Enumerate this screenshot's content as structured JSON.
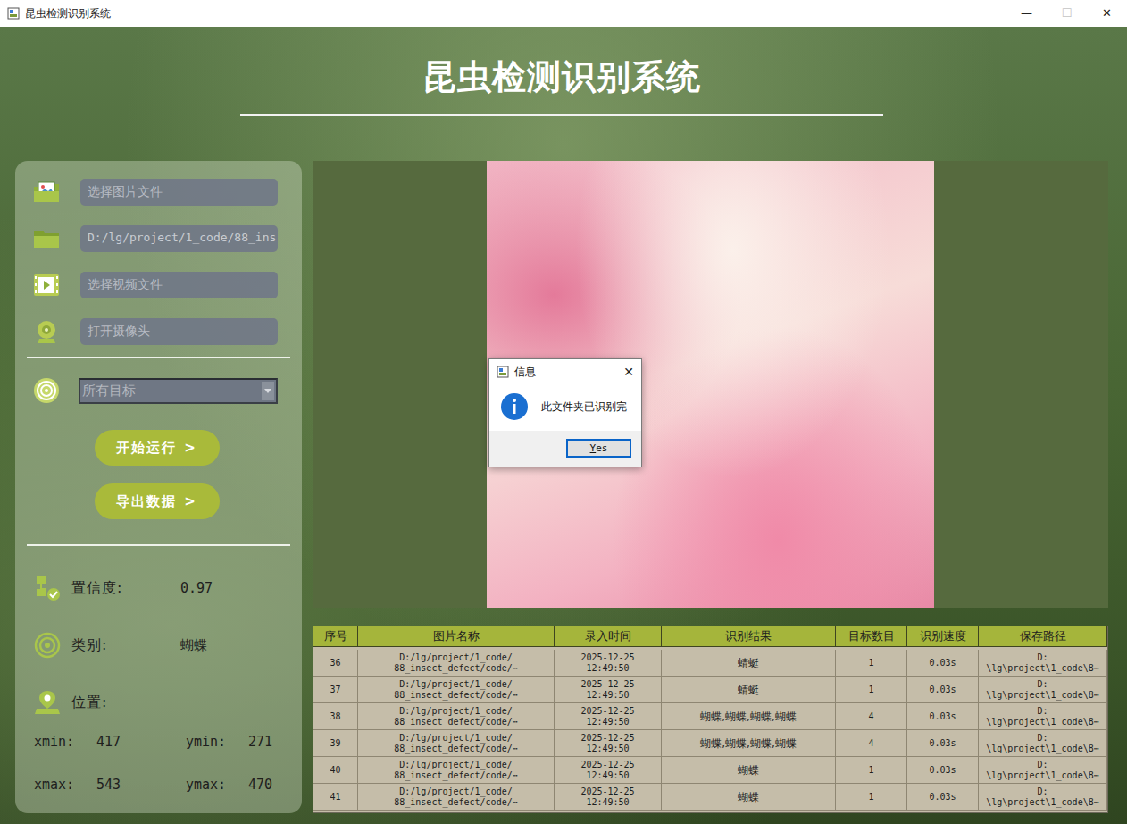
{
  "window": {
    "title": "昆虫检测识别系统",
    "controls": [
      {
        "glyph": "—",
        "disabled": false
      },
      {
        "glyph": "☐",
        "disabled": true
      },
      {
        "glyph": "✕",
        "disabled": false
      }
    ]
  },
  "header": {
    "title": "昆虫检测识别系统"
  },
  "inputs": [
    {
      "kind": "image",
      "text": "选择图片文件",
      "filled": false
    },
    {
      "kind": "folder",
      "text": "D:/lg/project/1_code/88_ins",
      "filled": true
    },
    {
      "kind": "video",
      "text": "选择视频文件",
      "filled": false
    },
    {
      "kind": "camera",
      "text": "打开摄像头",
      "filled": false
    }
  ],
  "target_select": {
    "value": "所有目标"
  },
  "buttons": [
    {
      "label": "开始运行",
      "chevron": ">"
    },
    {
      "label": "导出数据",
      "chevron": ">"
    }
  ],
  "stats": {
    "confidence": {
      "label": "置信度:",
      "value": "0.97"
    },
    "category": {
      "label": "类别:",
      "value": "蝴蝶"
    },
    "position": {
      "label": "位置:"
    },
    "coords": [
      {
        "label": "xmin:",
        "value": "417"
      },
      {
        "label": "ymin:",
        "value": "271"
      },
      {
        "label": "xmax:",
        "value": "543"
      },
      {
        "label": "ymax:",
        "value": "470"
      }
    ]
  },
  "dialog": {
    "title": "信息",
    "close": "✕",
    "message": "此文件夹已识别完",
    "button": "Yes"
  },
  "table": {
    "columns": [
      "序号",
      "图片名称",
      "录入时间",
      "识别结果",
      "目标数目",
      "识别速度",
      "保存路径"
    ],
    "rows": [
      {
        "index": "36",
        "name": [
          "D:/lg/project/1_code/",
          "88_insect_defect/code/⋯"
        ],
        "time": [
          "2025-12-25",
          "12:49:50"
        ],
        "result": "蜻蜓",
        "count": "1",
        "speed": "0.03s",
        "path": [
          "D:",
          "\\lg\\project\\1_code\\8⋯"
        ]
      },
      {
        "index": "37",
        "name": [
          "D:/lg/project/1_code/",
          "88_insect_defect/code/⋯"
        ],
        "time": [
          "2025-12-25",
          "12:49:50"
        ],
        "result": "蜻蜓",
        "count": "1",
        "speed": "0.03s",
        "path": [
          "D:",
          "\\lg\\project\\1_code\\8⋯"
        ]
      },
      {
        "index": "38",
        "name": [
          "D:/lg/project/1_code/",
          "88_insect_defect/code/⋯"
        ],
        "time": [
          "2025-12-25",
          "12:49:50"
        ],
        "result": "蝴蝶,蝴蝶,蝴蝶,蝴蝶",
        "count": "4",
        "speed": "0.03s",
        "path": [
          "D:",
          "\\lg\\project\\1_code\\8⋯"
        ]
      },
      {
        "index": "39",
        "name": [
          "D:/lg/project/1_code/",
          "88_insect_defect/code/⋯"
        ],
        "time": [
          "2025-12-25",
          "12:49:50"
        ],
        "result": "蝴蝶,蝴蝶,蝴蝶,蝴蝶",
        "count": "4",
        "speed": "0.03s",
        "path": [
          "D:",
          "\\lg\\project\\1_code\\8⋯"
        ]
      },
      {
        "index": "40",
        "name": [
          "D:/lg/project/1_code/",
          "88_insect_defect/code/⋯"
        ],
        "time": [
          "2025-12-25",
          "12:49:50"
        ],
        "result": "蝴蝶",
        "count": "1",
        "speed": "0.03s",
        "path": [
          "D:",
          "\\lg\\project\\1_code\\8⋯"
        ]
      },
      {
        "index": "41",
        "name": [
          "D:/lg/project/1_code/",
          "88_insect_defect/code/⋯"
        ],
        "time": [
          "2025-12-25",
          "12:49:50"
        ],
        "result": "蝴蝶",
        "count": "1",
        "speed": "0.03s",
        "path": [
          "D:",
          "\\lg\\project\\1_code\\8⋯"
        ]
      }
    ]
  }
}
